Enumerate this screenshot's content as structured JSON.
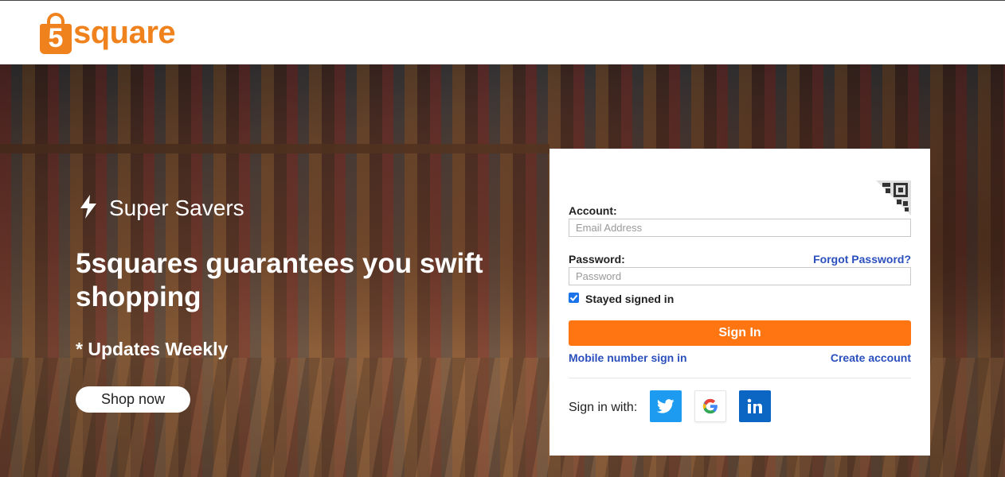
{
  "header": {
    "logo_number": "5",
    "logo_text": "square"
  },
  "hero": {
    "super_savers": "Super Savers",
    "headline": "5squares guarantees you swift shopping",
    "updates": "* Updates Weekly",
    "shop_now": "Shop now"
  },
  "login": {
    "account_label": "Account:",
    "email_placeholder": "Email Address",
    "password_label": "Password:",
    "forgot_password": "Forgot Password?",
    "password_placeholder": "Password",
    "stayed_signed_in": "Stayed signed in",
    "stayed_checked": true,
    "sign_in": "Sign In",
    "mobile_sign_in": "Mobile number sign in",
    "create_account": "Create account",
    "sign_in_with": "Sign in with:",
    "socials": [
      {
        "name": "twitter",
        "icon": "twitter-icon",
        "color": "#1d9bf0"
      },
      {
        "name": "google",
        "icon": "google-icon",
        "color": "#ffffff"
      },
      {
        "name": "linkedin",
        "icon": "linkedin-icon",
        "color": "#0a66c2"
      }
    ]
  },
  "colors": {
    "brand": "#f0821e",
    "button": "#ff7512",
    "link": "#2a4fbd"
  }
}
